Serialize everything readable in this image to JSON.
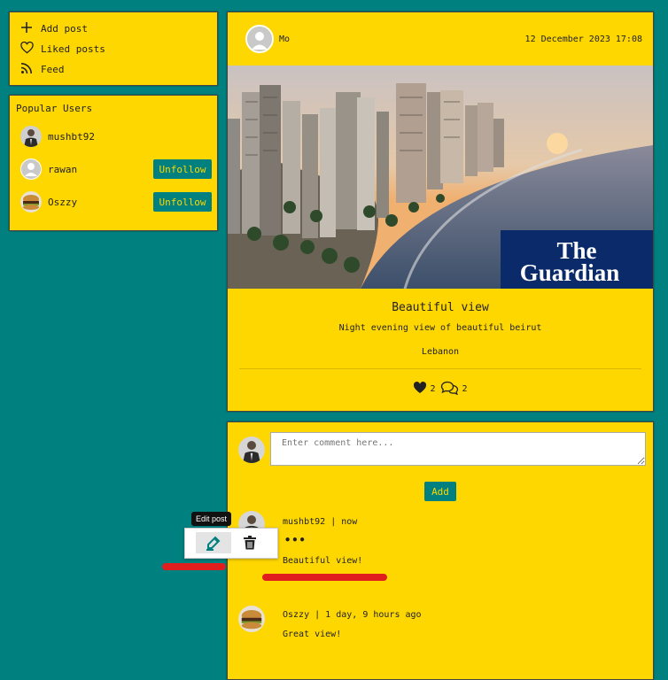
{
  "menu": {
    "items": [
      {
        "label": "Add post",
        "icon": "plus-icon"
      },
      {
        "label": "Liked posts",
        "icon": "heart-icon"
      },
      {
        "label": "Feed",
        "icon": "rss-icon"
      }
    ]
  },
  "popular": {
    "title": "Popular Users",
    "users": [
      {
        "name": "mushbt92",
        "button": ""
      },
      {
        "name": "rawan",
        "button": "Unfollow"
      },
      {
        "name": "Oszzy",
        "button": "Unfollow"
      }
    ]
  },
  "post": {
    "author": "Mo",
    "date": "12 December 2023 17:08",
    "image_badge": {
      "line1": "The",
      "line2": "Guardian"
    },
    "title": "Beautiful view",
    "description": "Night evening view of beautiful beirut",
    "location": "Lebanon",
    "likes": "2",
    "comments_count": "2"
  },
  "comments_section": {
    "placeholder": "Enter comment here...",
    "add_label": "Add",
    "comments": [
      {
        "user": "mushbt92",
        "time": "| now",
        "text": "Beautiful view!",
        "more": "•••"
      },
      {
        "user": "Oszzy",
        "time": "| 1 day, 9 hours ago",
        "text": "Great view!"
      }
    ]
  },
  "popup": {
    "tooltip": "Edit post"
  },
  "colors": {
    "background": "#00807f",
    "panel": "#ffd700",
    "accent": "#00807f",
    "highlight": "#e01e1e"
  }
}
